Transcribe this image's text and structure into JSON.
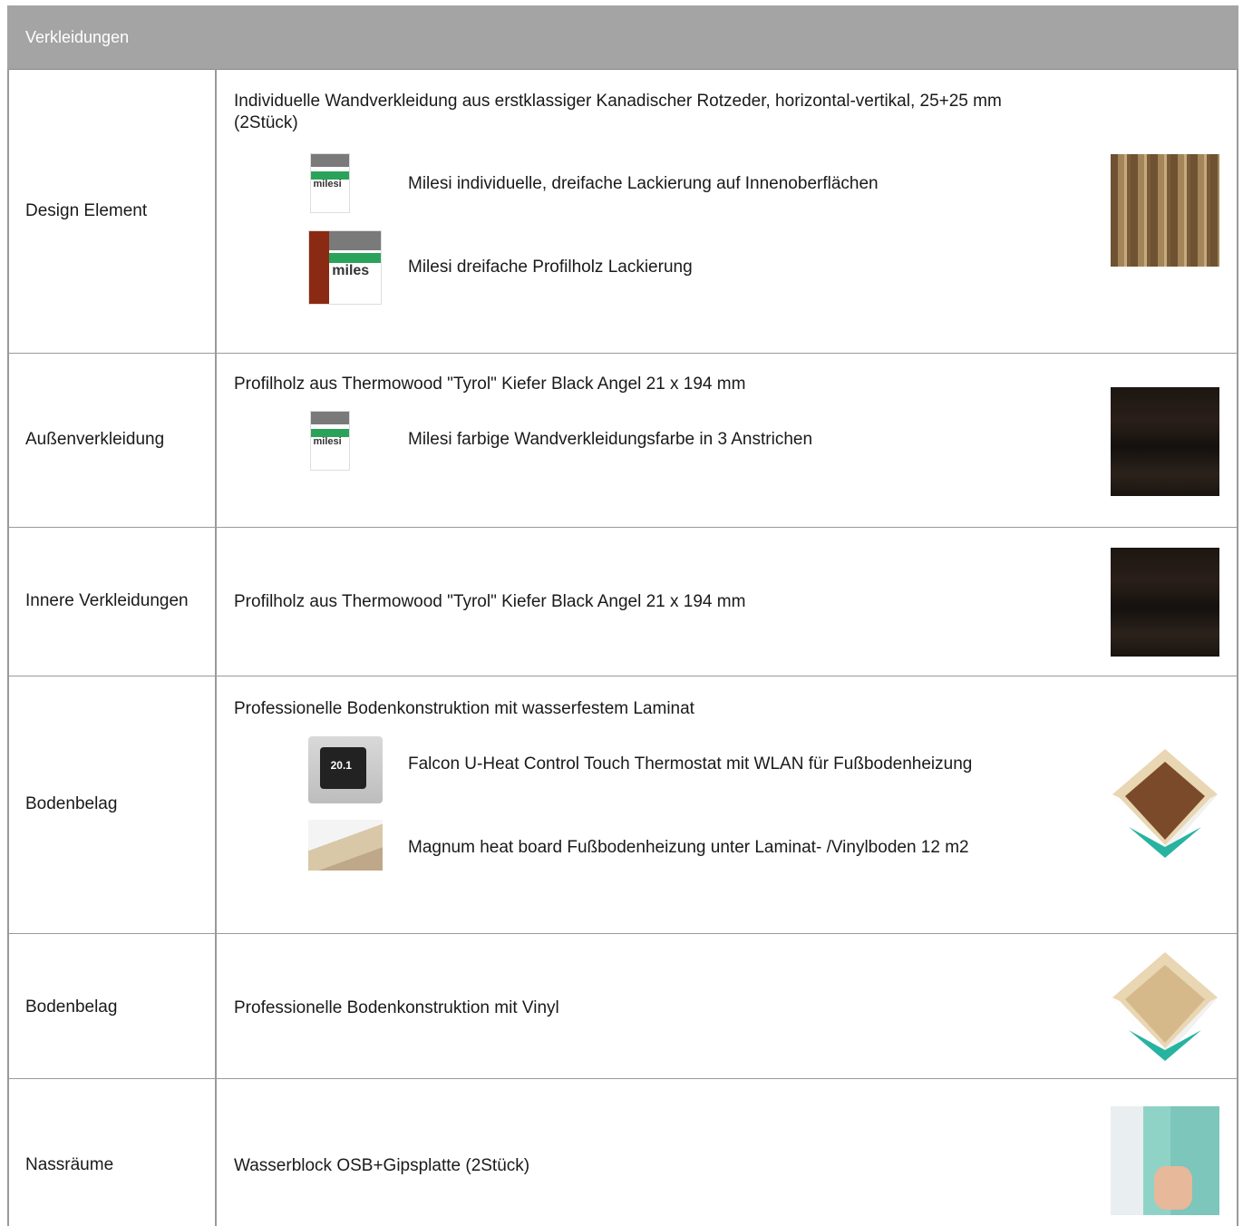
{
  "section": {
    "title": "Verkleidungen"
  },
  "rows": [
    {
      "label": "Design Element",
      "description": "Individuelle Wandverkleidung aus erstklassiger Kanadischer Rotzeder, horizontal-vertikal, 25+25 mm",
      "description_line2": " (2Stück)",
      "sub_items": [
        {
          "icon": "milesi-paint-can-icon",
          "text": "Milesi individuelle, dreifache Lackierung auf Innenoberflächen",
          "brand": "milesi"
        },
        {
          "icon": "milesi-wood-paint-can-icon",
          "text": "Milesi dreifache Profilholz Lackierung",
          "brand": "miles"
        }
      ],
      "image": "cedar-slats-image"
    },
    {
      "label": "Außenverkleidung",
      "description": "Profilholz aus Thermowood \"Tyrol\" Kiefer Black Angel 21 x 194 mm",
      "sub_items": [
        {
          "icon": "milesi-paint-can-icon",
          "text": "Milesi farbige Wandverkleidungsfarbe in 3 Anstrichen",
          "brand": "milesi"
        }
      ],
      "image": "dark-wood-texture-image"
    },
    {
      "label": "Innere Verkleidungen",
      "description": "Profilholz aus Thermowood \"Tyrol\" Kiefer Black Angel 21 x 194 mm",
      "image": "dark-wood-texture-image"
    },
    {
      "label": "Bodenbelag",
      "description": "Professionelle Bodenkonstruktion mit wasserfestem Laminat",
      "sub_items": [
        {
          "icon": "thermostat-icon",
          "text": "Falcon U-Heat Control Touch Thermostat mit WLAN für Fußbodenheizung",
          "display": "20.1"
        },
        {
          "icon": "heat-board-icon",
          "text": "Magnum heat board Fußbodenheizung unter Laminat- /Vinylboden 12 m2"
        }
      ],
      "image": "floor-construction-laminate-image"
    },
    {
      "label": "Bodenbelag",
      "description": "Professionelle Bodenkonstruktion mit Vinyl",
      "image": "floor-construction-vinyl-image"
    },
    {
      "label": "Nassräume",
      "description": "Wasserblock OSB+Gipsplatte  (2Stück)",
      "image": "wet-room-board-image"
    }
  ]
}
